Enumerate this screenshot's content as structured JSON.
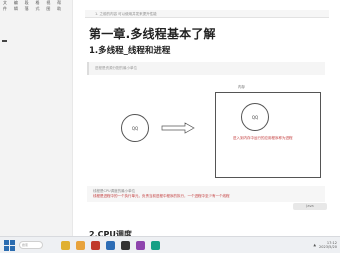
{
  "menubar": {
    "items": [
      "文件",
      "编辑",
      "段落",
      "格式",
      "视图",
      "帮助"
    ]
  },
  "document": {
    "prev_block_text": "1. 之前的内容 可以使用并发来提升性能",
    "chapter_title": "第一章.多线程基本了解",
    "section_title": "1.多线程_线程和进程",
    "quote_text": "进程是资源分配的最小单位",
    "diagram": {
      "memory_label": "内存",
      "left_circle_label": "QQ",
      "right_circle_label": "QQ",
      "red_note": "进入到内存中运行的应用程序称为进程"
    },
    "paragraph_lines": [
      "线程是CPU调度的最小单位",
      "线程是进程中的一个执行单元，负责当前进程中程序的执行，一个进程中至少有一个线程"
    ],
    "pill_label": "Java",
    "next_section_title": "2.CPU调度"
  },
  "taskbar": {
    "search_placeholder": "搜索",
    "apps": [
      {
        "icon": "chrome-icon",
        "color": "#e0b030"
      },
      {
        "icon": "explorer-icon",
        "color": "#e8a33c"
      },
      {
        "icon": "app-icon",
        "color": "#c0392b"
      },
      {
        "icon": "typora-icon",
        "color": "#2d6db5"
      },
      {
        "icon": "terminal-icon",
        "color": "#333333"
      },
      {
        "icon": "ide-icon",
        "color": "#8e44ad"
      },
      {
        "icon": "app-icon-2",
        "color": "#16a085"
      }
    ],
    "time": "17:12",
    "date": "2023/5/20"
  },
  "colors": {
    "accent": "#2b6cb0",
    "note_red": "#c23b3b"
  }
}
